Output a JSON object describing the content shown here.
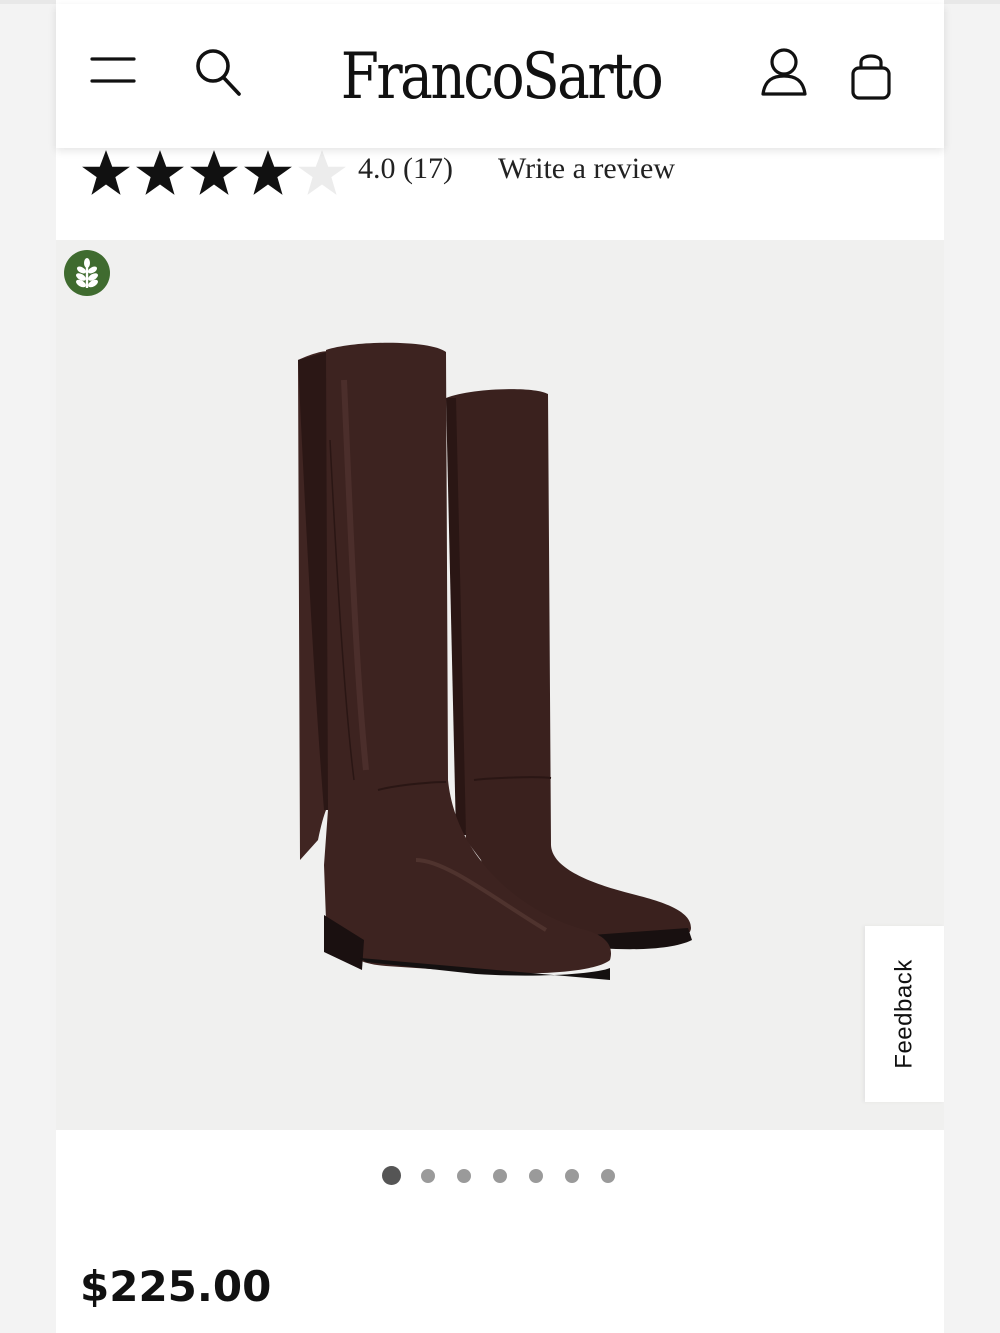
{
  "header": {
    "logo_text": "FrancoSarto",
    "menu_icon": "hamburger-menu-icon",
    "search_icon": "search-icon",
    "account_icon": "account-icon",
    "bag_icon": "shopping-bag-icon"
  },
  "rating": {
    "value": 4.0,
    "max": 5,
    "summary": "4.0 (17)",
    "review_link": "Write a review"
  },
  "product": {
    "image_alt": "Brown knee-high leather riding boots",
    "badge_icon": "sustainable-leaf-icon",
    "price": "$225.00"
  },
  "carousel": {
    "count": 7,
    "active_index": 0
  },
  "feedback": {
    "label": "Feedback"
  },
  "colors": {
    "eco_badge": "#3f6b2f",
    "boot_leather": "#3d2320",
    "image_bg": "#f0f0ef"
  }
}
